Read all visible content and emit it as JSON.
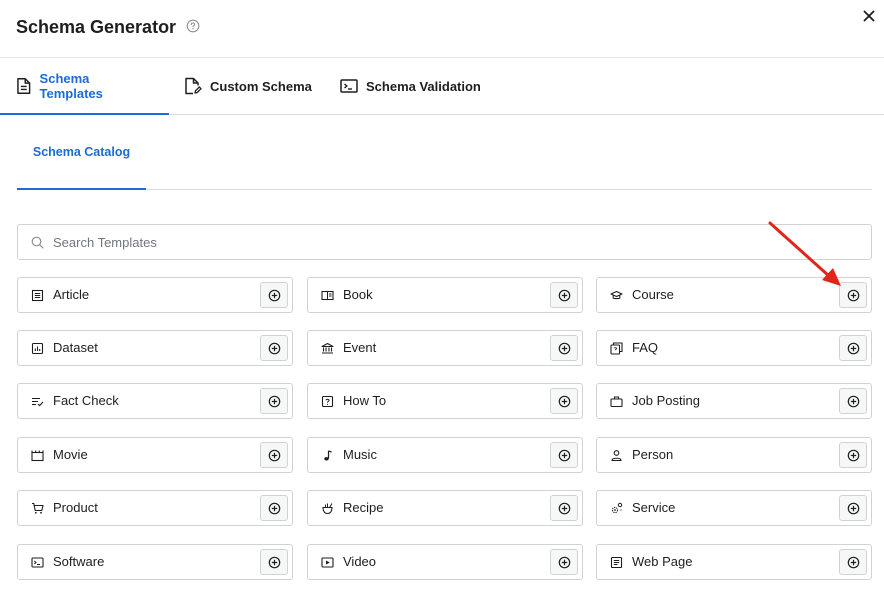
{
  "header": {
    "title": "Schema Generator",
    "help_icon": "question-circle-icon",
    "close_icon": "close-icon"
  },
  "tabs": [
    {
      "label": "Schema Templates",
      "icon": "document-icon",
      "active": true
    },
    {
      "label": "Custom Schema",
      "icon": "edit-document-icon",
      "active": false
    },
    {
      "label": "Schema Validation",
      "icon": "terminal-icon",
      "active": false
    }
  ],
  "subtabs": [
    {
      "label": "Schema Catalog",
      "active": true
    }
  ],
  "search": {
    "placeholder": "Search Templates",
    "value": "",
    "icon": "search-icon"
  },
  "templates": [
    {
      "label": "Article",
      "icon": "article-icon"
    },
    {
      "label": "Book",
      "icon": "book-icon"
    },
    {
      "label": "Course",
      "icon": "graduation-cap-icon"
    },
    {
      "label": "Dataset",
      "icon": "dataset-icon"
    },
    {
      "label": "Event",
      "icon": "bank-icon"
    },
    {
      "label": "FAQ",
      "icon": "faq-icon"
    },
    {
      "label": "Fact Check",
      "icon": "list-check-icon"
    },
    {
      "label": "How To",
      "icon": "question-box-icon"
    },
    {
      "label": "Job Posting",
      "icon": "briefcase-icon"
    },
    {
      "label": "Movie",
      "icon": "clapperboard-icon"
    },
    {
      "label": "Music",
      "icon": "music-note-icon"
    },
    {
      "label": "Person",
      "icon": "person-icon"
    },
    {
      "label": "Product",
      "icon": "cart-icon"
    },
    {
      "label": "Recipe",
      "icon": "chef-icon"
    },
    {
      "label": "Service",
      "icon": "gears-icon"
    },
    {
      "label": "Software",
      "icon": "terminal-icon"
    },
    {
      "label": "Video",
      "icon": "play-icon"
    },
    {
      "label": "Web Page",
      "icon": "webpage-icon"
    }
  ],
  "add_icon": "plus-circle-icon",
  "annotation": {
    "icon": "red-arrow-icon",
    "color": "#e0251b"
  },
  "colors": {
    "accent": "#1c6bd6",
    "border": "#d0d3d6",
    "text": "#1e1e1e"
  }
}
